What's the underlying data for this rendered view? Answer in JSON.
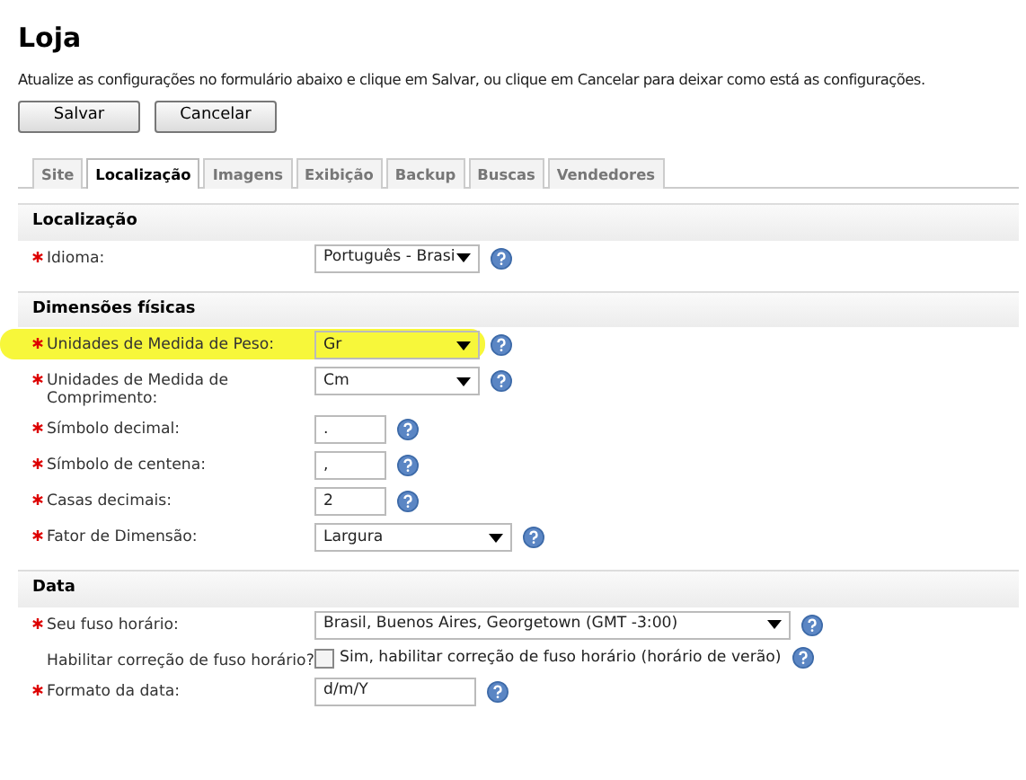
{
  "title": "Loja",
  "description": "Atualize as configurações no formulário abaixo e clique em Salvar, ou clique em Cancelar para deixar como está as configurações.",
  "buttons": [
    "Salvar",
    "Cancelar"
  ],
  "tabs": [
    {
      "label": "Site",
      "selected": false
    },
    {
      "label": "Localização",
      "selected": true
    },
    {
      "label": "Imagens",
      "selected": false
    },
    {
      "label": "Exibição",
      "selected": false
    },
    {
      "label": "Backup",
      "selected": false
    },
    {
      "label": "Buscas",
      "selected": false
    },
    {
      "label": "Vendedores",
      "selected": false
    }
  ],
  "sections": [
    {
      "title": "Localização",
      "rows": [
        {
          "label": "Idioma:",
          "required": true,
          "kind": "select",
          "value": "Português - Brasi",
          "highlighted": false
        }
      ]
    },
    {
      "title": "Dimensões físicas",
      "rows": [
        {
          "label": "Unidades de Medida de Peso:",
          "required": true,
          "kind": "select",
          "value": "Gr",
          "highlighted": true
        },
        {
          "label": "Unidades de Medida de Comprimento:",
          "required": true,
          "kind": "select",
          "value": "Cm",
          "highlighted": false
        },
        {
          "label": "Símbolo decimal:",
          "required": true,
          "kind": "text",
          "value": ".",
          "highlighted": false
        },
        {
          "label": "Símbolo de centena:",
          "required": true,
          "kind": "text",
          "value": ",",
          "highlighted": false
        },
        {
          "label": "Casas decimais:",
          "required": true,
          "kind": "text",
          "value": "2",
          "highlighted": false
        },
        {
          "label": "Fator de Dimensão:",
          "required": true,
          "kind": "select",
          "value": "Largura",
          "highlighted": false
        }
      ]
    },
    {
      "title": "Data",
      "rows": [
        {
          "label": "Seu fuso horário:",
          "required": true,
          "kind": "select",
          "value": "Brasil, Buenos Aires, Georgetown (GMT -3:00)",
          "highlighted": false
        },
        {
          "label": "Habilitar correção de fuso horário?",
          "required": false,
          "kind": "checkbox",
          "value": "Sim, habilitar correção de fuso horário (horário de verão)",
          "checked": false,
          "highlighted": false
        },
        {
          "label": "Formato da data:",
          "required": true,
          "kind": "text",
          "value": "d/m/Y",
          "highlighted": false
        }
      ]
    }
  ]
}
